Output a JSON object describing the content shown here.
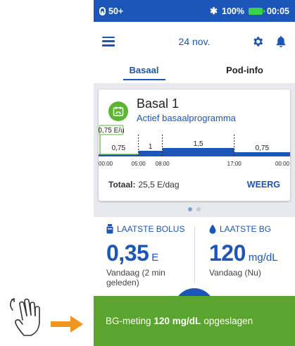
{
  "status_bar": {
    "pod_reservoir": "50+",
    "battery_percent": "100%",
    "time": "00:05",
    "battery_color": "#3bd14a"
  },
  "app_bar": {
    "date": "24 nov.",
    "menu_icon": "hamburger-icon",
    "settings_icon": "gear-icon",
    "notifications_icon": "bell-icon"
  },
  "tabs": [
    {
      "label": "Basaal",
      "active": true
    },
    {
      "label": "Pod-info",
      "active": false
    }
  ],
  "basal_card": {
    "program_name": "Basal 1",
    "program_status": "Actief basaalprogramma",
    "current_rate": "0,75 E/u",
    "total_label": "Totaal:",
    "total_value": "25,5 E/dag",
    "view_button": "WEERG"
  },
  "chart_data": {
    "type": "step",
    "x_ticks": [
      "00:00",
      "05:00",
      "08:00",
      "17:00",
      "00:00"
    ],
    "segments": [
      {
        "start": "00:00",
        "end": "05:00",
        "rate": 0.75,
        "label": "0,75"
      },
      {
        "start": "05:00",
        "end": "08:00",
        "rate": 1.0,
        "label": "1"
      },
      {
        "start": "08:00",
        "end": "17:00",
        "rate": 1.5,
        "label": "1,5"
      },
      {
        "start": "17:00",
        "end": "24:00",
        "rate": 0.75,
        "label": "0,75"
      }
    ],
    "active_segment": 0,
    "color": "#1c56b8"
  },
  "pager": {
    "count": 2,
    "active": 0
  },
  "last_bolus": {
    "heading": "LAATSTE BOLUS",
    "value": "0,35",
    "unit": "E",
    "when": "Vandaag (2 min geleden)"
  },
  "last_bg": {
    "heading": "LAATSTE BG",
    "value": "120",
    "unit": "mg/dL",
    "when": "Vandaag (Nu)"
  },
  "toast": {
    "prefix": "BG-meting",
    "value": "120 mg/dL",
    "suffix": "opgeslagen",
    "color": "#5ba42f"
  },
  "gesture": {
    "hand_icon": "swipe-up-hand-icon",
    "arrow_icon": "arrow-right-icon",
    "arrow_color": "#f0961e"
  }
}
